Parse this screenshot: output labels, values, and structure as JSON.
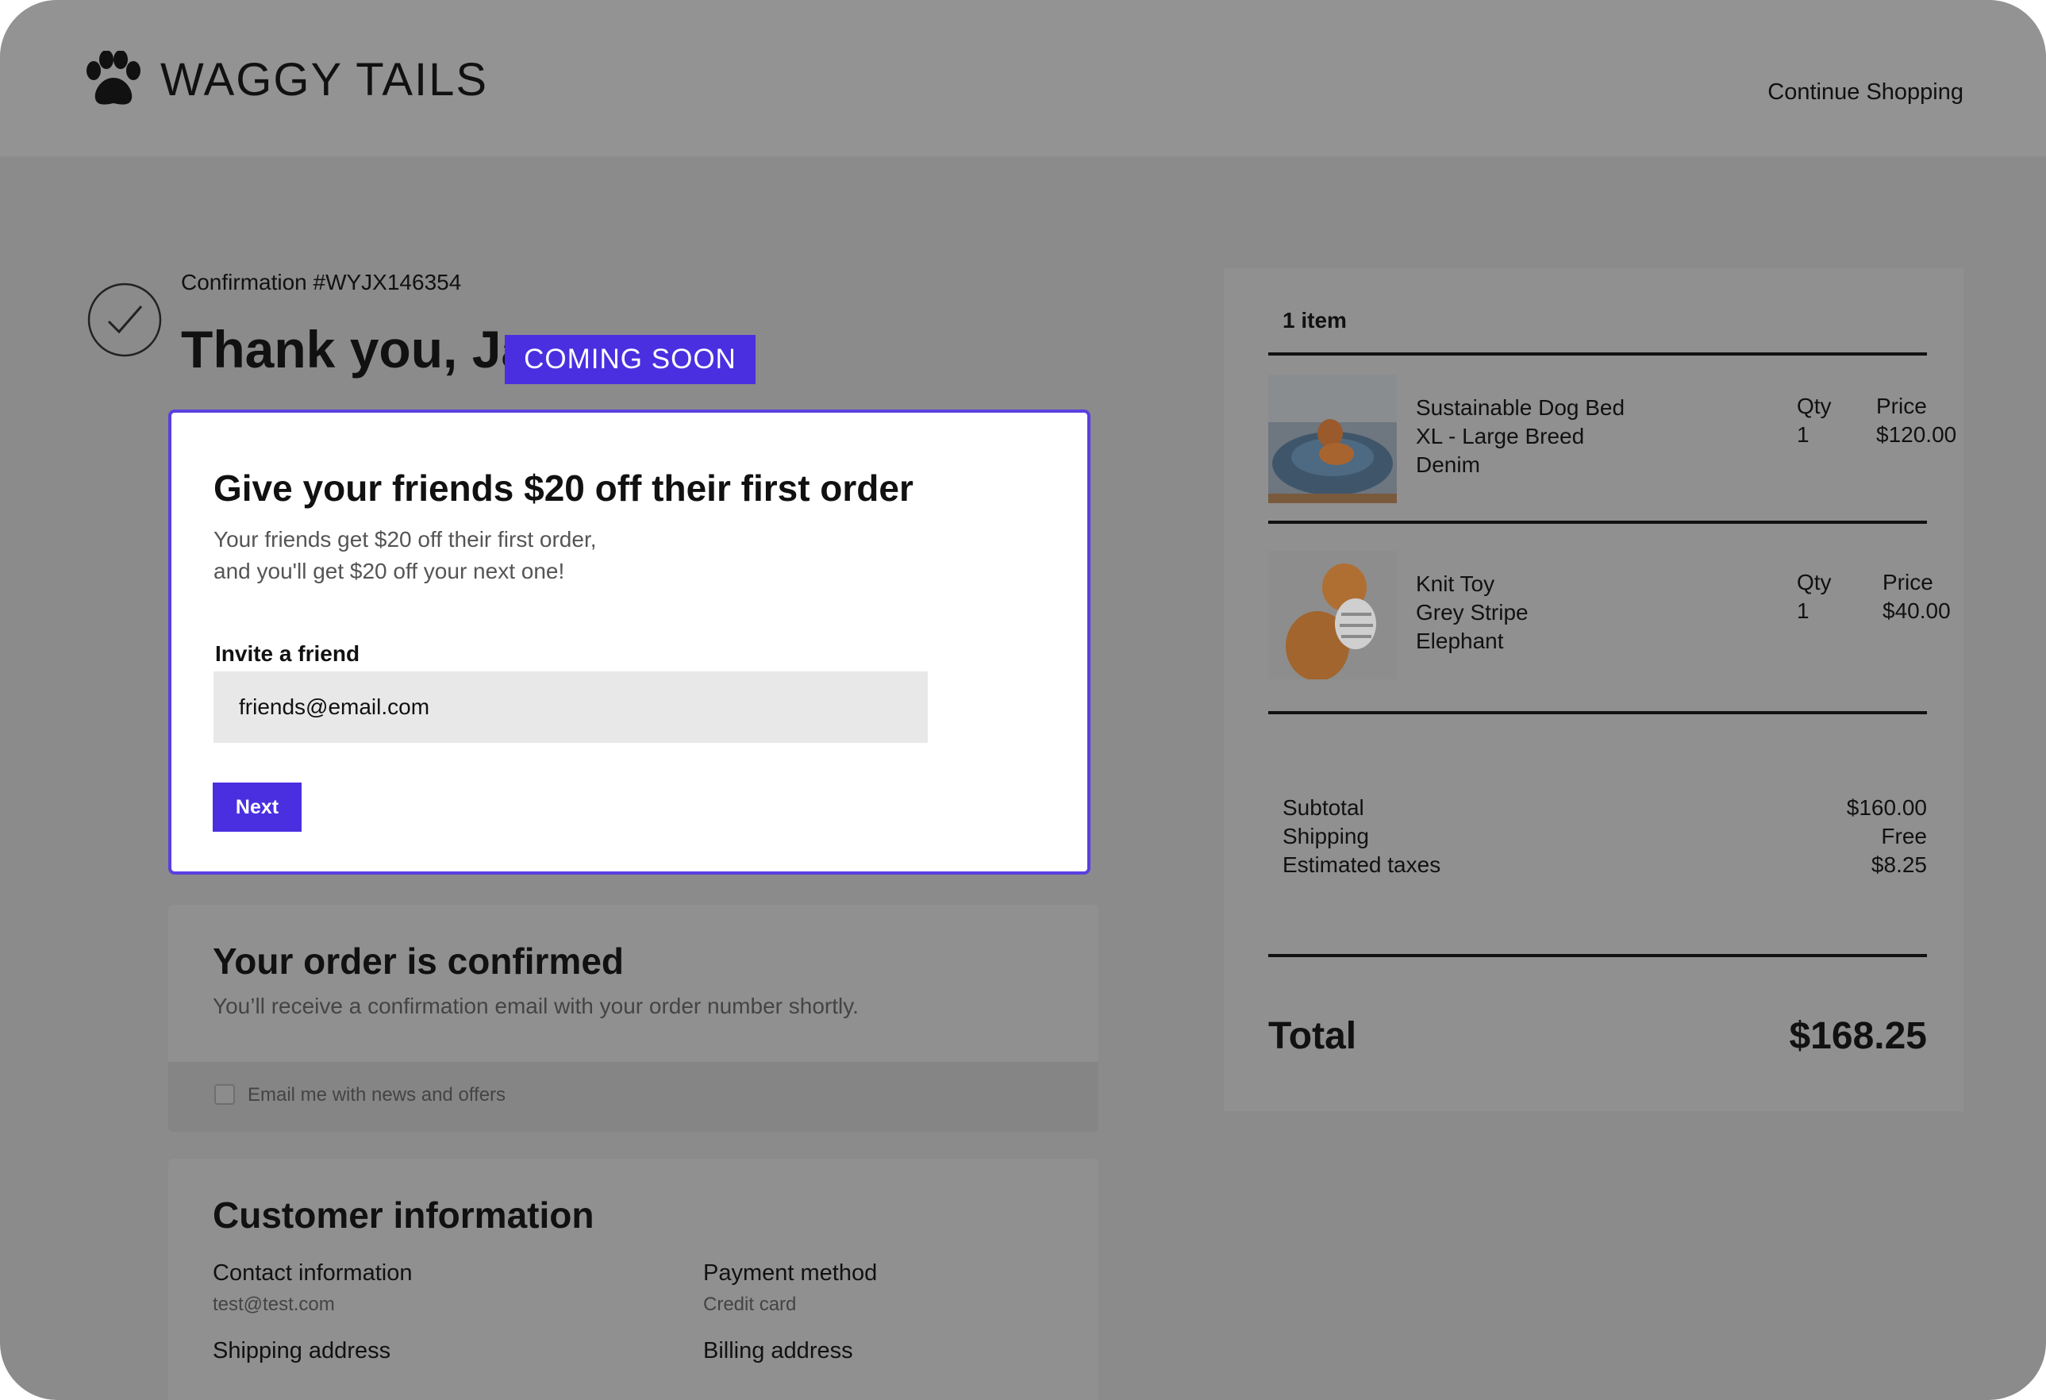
{
  "header": {
    "brand": "WAGGY TAILS",
    "continue_label": "Continue Shopping"
  },
  "confirmation": {
    "number": "Confirmation #WYJX146354",
    "greeting": "Thank you, Ja",
    "coming_soon": "COMING SOON"
  },
  "referral": {
    "title": "Give your friends $20 off their first order",
    "desc_line1": "Your friends get $20 off their first order,",
    "desc_line2": "and you'll get $20 off your next one!",
    "invite_label": "Invite a friend",
    "invite_value": "friends@email.com",
    "next_label": "Next"
  },
  "order": {
    "title": "Your order is confirmed",
    "desc": "You’ll receive a confirmation email with your order number shortly.",
    "optin_label": "Email me with news and offers"
  },
  "customer": {
    "title": "Customer information",
    "contact_label": "Contact information",
    "contact_value": "test@test.com",
    "payment_label": "Payment method",
    "payment_value": "Credit card",
    "shipping_label": "Shipping address",
    "billing_label": "Billing address"
  },
  "summary": {
    "item_count": "1 item",
    "items": [
      {
        "name_line1": "Sustainable Dog Bed",
        "name_line2": "XL - Large Breed",
        "name_line3": "Denim",
        "qty_label": "Qty",
        "qty": "1",
        "price_label": "Price",
        "price": "$120.00"
      },
      {
        "name_line1": "Knit Toy",
        "name_line2": "Grey Stripe",
        "name_line3": "Elephant",
        "qty_label": "Qty",
        "qty": "1",
        "price_label": "Price",
        "price": "$40.00"
      }
    ],
    "subtotal_label": "Subtotal",
    "subtotal": "$160.00",
    "shipping_label": "Shipping",
    "shipping": "Free",
    "taxes_label": "Estimated taxes",
    "taxes": "$8.25",
    "total_label": "Total",
    "total": "$168.25"
  },
  "colors": {
    "accent": "#4a2fe0",
    "overlay": "#8b8b8b"
  },
  "icons": {
    "logo": "paw-icon",
    "status": "check-circle-icon"
  }
}
